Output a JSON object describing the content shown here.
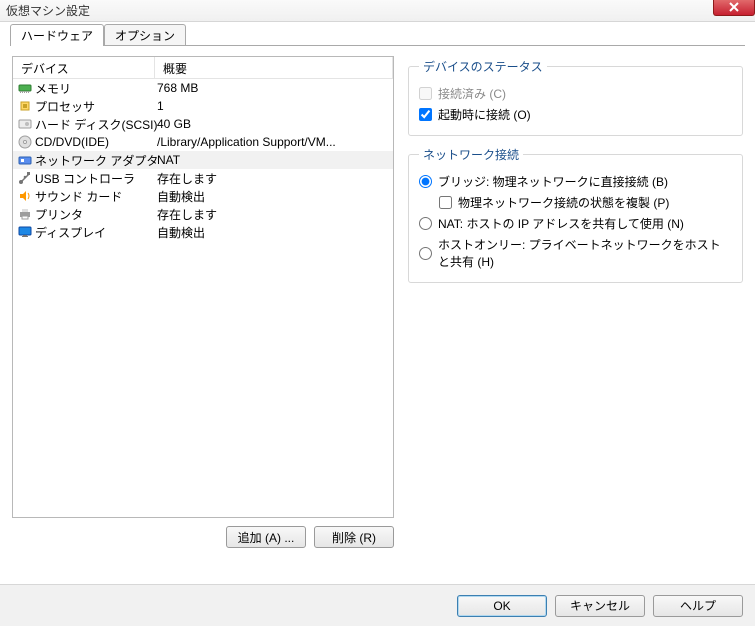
{
  "title": "仮想マシン設定",
  "tabs": [
    "ハードウェア",
    "オプション"
  ],
  "columns": {
    "device": "デバイス",
    "summary": "概要"
  },
  "devices": [
    {
      "icon": "memory",
      "name": "メモリ",
      "summary": "768 MB"
    },
    {
      "icon": "cpu",
      "name": "プロセッサ",
      "summary": "1"
    },
    {
      "icon": "disk",
      "name": "ハード ディスク(SCSI)",
      "summary": "40 GB"
    },
    {
      "icon": "cd",
      "name": "CD/DVD(IDE)",
      "summary": "/Library/Application Support/VM..."
    },
    {
      "icon": "nic",
      "name": "ネットワーク アダプタ",
      "summary": "NAT",
      "selected": true
    },
    {
      "icon": "usb",
      "name": "USB コントローラ",
      "summary": "存在します"
    },
    {
      "icon": "sound",
      "name": "サウンド カード",
      "summary": "自動検出"
    },
    {
      "icon": "printer",
      "name": "プリンタ",
      "summary": "存在します"
    },
    {
      "icon": "display",
      "name": "ディスプレイ",
      "summary": "自動検出"
    }
  ],
  "buttons": {
    "add": "追加 (A) ...",
    "remove": "削除 (R)",
    "ok": "OK",
    "cancel": "キャンセル",
    "help": "ヘルプ"
  },
  "status_group": {
    "legend": "デバイスのステータス",
    "connected": "接続済み (C)",
    "connect_at_power_on": "起動時に接続 (O)"
  },
  "net_group": {
    "legend": "ネットワーク接続",
    "bridged": "ブリッジ: 物理ネットワークに直接接続 (B)",
    "replicate": "物理ネットワーク接続の状態を複製 (P)",
    "nat": "NAT: ホストの IP アドレスを共有して使用 (N)",
    "hostonly": "ホストオンリー: プライベートネットワークをホストと共有 (H)"
  }
}
